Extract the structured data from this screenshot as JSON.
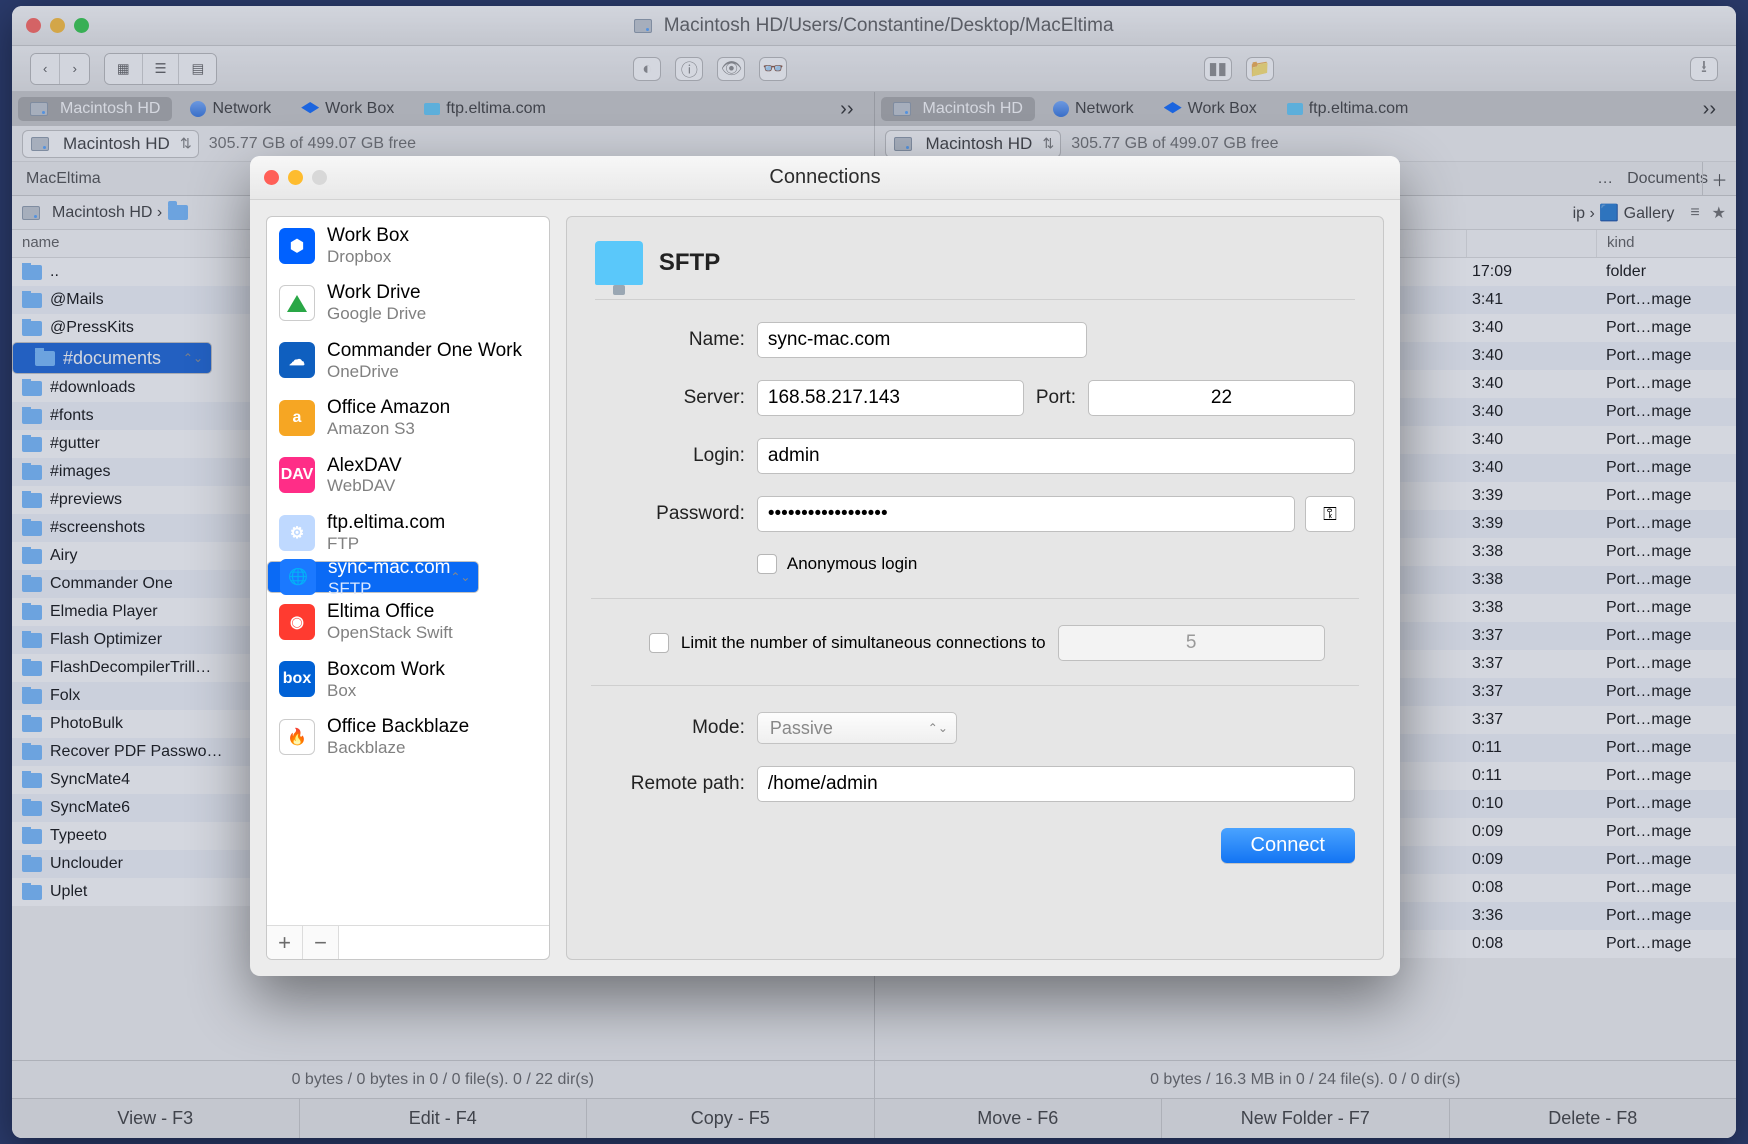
{
  "window": {
    "title_prefix": "📀",
    "title": "Macintosh HD/Users/Constantine/Desktop/MacEltima"
  },
  "tabs": {
    "left": [
      {
        "label": "Macintosh HD",
        "active": true,
        "icon": "hd"
      },
      {
        "label": "Network",
        "icon": "net"
      },
      {
        "label": "Work Box",
        "icon": "db"
      },
      {
        "label": "ftp.eltima.com",
        "icon": "ftp"
      }
    ],
    "right": [
      {
        "label": "Macintosh HD",
        "active": true,
        "icon": "hd"
      },
      {
        "label": "Network",
        "icon": "net"
      },
      {
        "label": "Work Box",
        "icon": "db"
      },
      {
        "label": "ftp.eltima.com",
        "icon": "ftp"
      }
    ]
  },
  "drive": {
    "label": "Macintosh HD",
    "free": "305.77 GB of 499.07 GB free"
  },
  "columns": {
    "left_tab": "MacEltima",
    "right_tab": "Documents"
  },
  "breadcrumb": {
    "left": "Macintosh HD ›",
    "right_end": "ip › 🟦 Gallery"
  },
  "list_headers": {
    "name": "name",
    "time": "",
    "kind": "kind"
  },
  "left_rows": [
    {
      "n": "..",
      "t": "",
      "k": ""
    },
    {
      "n": "@Mails",
      "t": "",
      "k": ""
    },
    {
      "n": "@PressKits",
      "t": "",
      "k": ""
    },
    {
      "n": "#documents",
      "t": "",
      "k": "",
      "sel": true
    },
    {
      "n": "#downloads",
      "t": "",
      "k": ""
    },
    {
      "n": "#fonts",
      "t": "",
      "k": ""
    },
    {
      "n": "#gutter",
      "t": "",
      "k": ""
    },
    {
      "n": "#images",
      "t": "",
      "k": ""
    },
    {
      "n": "#previews",
      "t": "",
      "k": ""
    },
    {
      "n": "#screenshots",
      "t": "",
      "k": ""
    },
    {
      "n": "Airy",
      "t": "",
      "k": ""
    },
    {
      "n": "Commander One",
      "t": "",
      "k": ""
    },
    {
      "n": "Elmedia Player",
      "t": "",
      "k": ""
    },
    {
      "n": "Flash Optimizer",
      "t": "",
      "k": ""
    },
    {
      "n": "FlashDecompilerTrill…",
      "t": "",
      "k": ""
    },
    {
      "n": "Folx",
      "t": "",
      "k": ""
    },
    {
      "n": "PhotoBulk",
      "t": "",
      "k": ""
    },
    {
      "n": "Recover PDF Passwo…",
      "t": "",
      "k": ""
    },
    {
      "n": "SyncMate4",
      "t": "",
      "k": ""
    },
    {
      "n": "SyncMate6",
      "t": "",
      "k": ""
    },
    {
      "n": "Typeeto",
      "t": "",
      "k": ""
    },
    {
      "n": "Unclouder",
      "t": "",
      "k": ""
    },
    {
      "n": "Uplet",
      "t": "",
      "k": ""
    }
  ],
  "right_rows": [
    {
      "n": "",
      "t": "17:09",
      "k": "folder"
    },
    {
      "n": "",
      "t": "3:41",
      "k": "Port…mage"
    },
    {
      "n": "",
      "t": "3:40",
      "k": "Port…mage"
    },
    {
      "n": "",
      "t": "3:40",
      "k": "Port…mage"
    },
    {
      "n": "",
      "t": "3:40",
      "k": "Port…mage"
    },
    {
      "n": "",
      "t": "3:40",
      "k": "Port…mage"
    },
    {
      "n": "",
      "t": "3:40",
      "k": "Port…mage"
    },
    {
      "n": "",
      "t": "3:40",
      "k": "Port…mage"
    },
    {
      "n": "",
      "t": "3:39",
      "k": "Port…mage"
    },
    {
      "n": "",
      "t": "3:39",
      "k": "Port…mage"
    },
    {
      "n": "",
      "t": "3:38",
      "k": "Port…mage"
    },
    {
      "n": "",
      "t": "3:38",
      "k": "Port…mage"
    },
    {
      "n": "",
      "t": "3:38",
      "k": "Port…mage"
    },
    {
      "n": "",
      "t": "3:37",
      "k": "Port…mage"
    },
    {
      "n": "",
      "t": "3:37",
      "k": "Port…mage"
    },
    {
      "n": "",
      "t": "3:37",
      "k": "Port…mage"
    },
    {
      "n": "",
      "t": "3:37",
      "k": "Port…mage"
    },
    {
      "n": "",
      "t": "0:11",
      "k": "Port…mage"
    },
    {
      "n": "",
      "t": "0:11",
      "k": "Port…mage"
    },
    {
      "n": "",
      "t": "0:10",
      "k": "Port…mage"
    },
    {
      "n": "",
      "t": "0:09",
      "k": "Port…mage"
    },
    {
      "n": "",
      "t": "0:09",
      "k": "Port…mage"
    },
    {
      "n": "",
      "t": "0:08",
      "k": "Port…mage"
    },
    {
      "n": "",
      "t": "3:36",
      "k": "Port…mage"
    },
    {
      "n": "",
      "t": "0:08",
      "k": "Port…mage"
    }
  ],
  "status": {
    "left": "0 bytes / 0 bytes in 0 / 0 file(s). 0 / 22 dir(s)",
    "right": "0 bytes / 16.3 MB in 0 / 24 file(s). 0 / 0 dir(s)"
  },
  "fbar": [
    "View - F3",
    "Edit - F4",
    "Copy - F5",
    "Move - F6",
    "New Folder - F7",
    "Delete - F8"
  ],
  "dialog": {
    "title": "Connections",
    "sidebar": [
      {
        "name": "Work Box",
        "sub": "Dropbox",
        "ico": "dropbox"
      },
      {
        "name": "Work Drive",
        "sub": "Google Drive",
        "ico": "gdrive"
      },
      {
        "name": "Commander One Work",
        "sub": "OneDrive",
        "ico": "onedrive"
      },
      {
        "name": "Office Amazon",
        "sub": "Amazon S3",
        "ico": "s3"
      },
      {
        "name": "AlexDAV",
        "sub": "WebDAV",
        "ico": "dav"
      },
      {
        "name": "ftp.eltima.com",
        "sub": "FTP",
        "ico": "ftp"
      },
      {
        "name": "sync-mac.com",
        "sub": "SFTP",
        "ico": "sftp",
        "sel": true
      },
      {
        "name": "Eltima Office",
        "sub": "OpenStack Swift",
        "ico": "swift"
      },
      {
        "name": "Boxcom Work",
        "sub": "Box",
        "ico": "box"
      },
      {
        "name": "Office Backblaze",
        "sub": "Backblaze",
        "ico": "bb"
      }
    ],
    "add": "+",
    "remove": "−",
    "form": {
      "proto": "SFTP",
      "labels": {
        "name": "Name:",
        "server": "Server:",
        "port": "Port:",
        "login": "Login:",
        "password": "Password:",
        "anon": "Anonymous login",
        "limit_pre": "Limit the number of simultaneous connections to",
        "mode": "Mode:",
        "remote": "Remote path:"
      },
      "name": "sync-mac.com",
      "server": "168.58.217.143",
      "port": "22",
      "login": "admin",
      "password": "••••••••••••••••••",
      "limit_value": "5",
      "mode": "Passive",
      "remote": "/home/admin",
      "connect": "Connect"
    }
  }
}
